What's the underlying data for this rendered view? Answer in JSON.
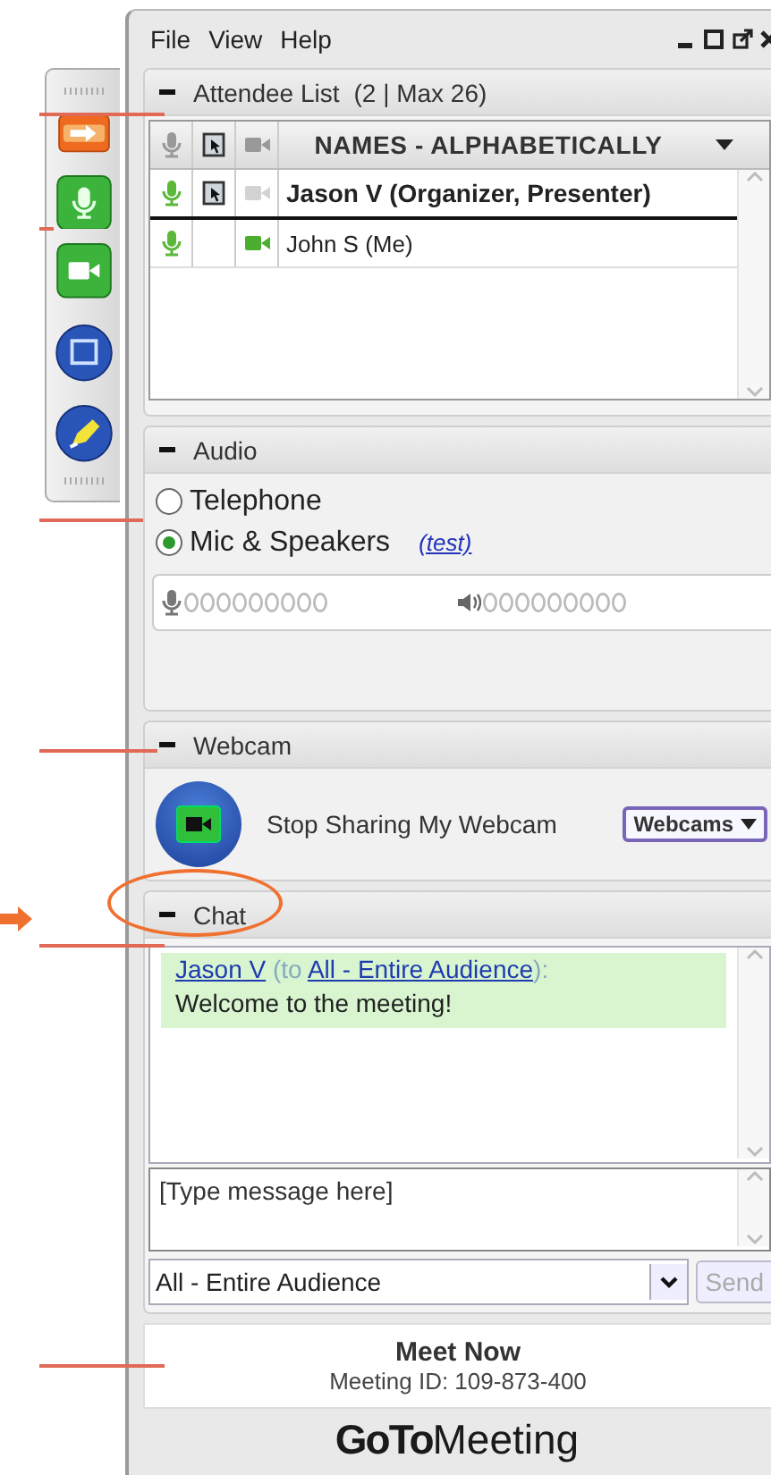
{
  "menu": [
    {
      "label": "File"
    },
    {
      "label": "View"
    },
    {
      "label": "Help"
    }
  ],
  "attendees": {
    "title": "Attendee List",
    "count": "(2 | Max 26)",
    "sort_header": "NAMES - ALPHABETICALLY",
    "rows": [
      {
        "name": "Jason V (Organizer, Presenter)",
        "organizer": true,
        "mic_on": true,
        "presenter": true,
        "webcam_on": false
      },
      {
        "name": "John S (Me)",
        "organizer": false,
        "mic_on": true,
        "presenter": false,
        "webcam_on": true
      }
    ]
  },
  "audio": {
    "title": "Audio",
    "options": [
      {
        "label": "Telephone",
        "selected": false
      },
      {
        "label": "Mic & Speakers",
        "selected": true
      }
    ],
    "test_link": "(test)"
  },
  "webcam": {
    "title": "Webcam",
    "action": "Stop Sharing My Webcam",
    "menu_button": "Webcams"
  },
  "chat": {
    "title": "Chat",
    "messages": [
      {
        "sender": "Jason V",
        "to_prefix": "(to",
        "recipient": "All - Entire Audience",
        "to_suffix": "):",
        "text": "Welcome to the meeting!"
      }
    ],
    "input": {
      "placeholder": "[Type message here]"
    },
    "recipient_select": "All - Entire Audience",
    "send": {
      "label": "Send",
      "disabled": true
    }
  },
  "footer": {
    "title": "Meet Now",
    "meeting_id": "Meeting ID: 109-873-400",
    "brand_bold": "GoTo",
    "brand_light": "Meeting"
  }
}
